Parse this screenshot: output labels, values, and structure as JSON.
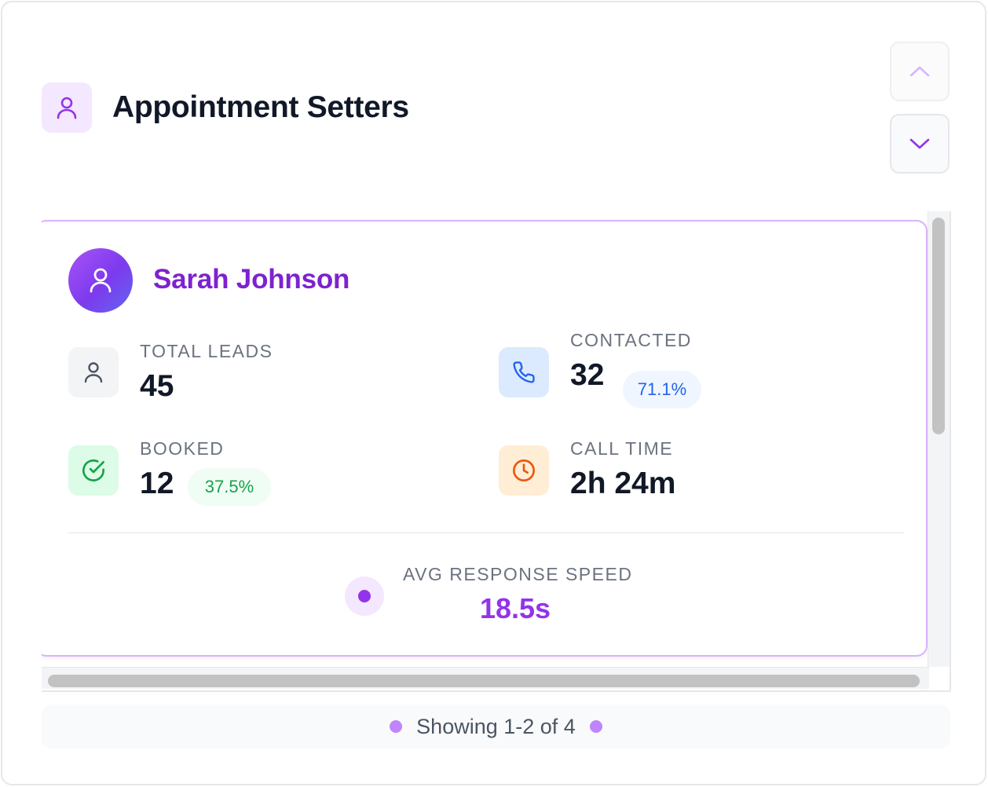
{
  "header": {
    "title": "Appointment Setters",
    "icon": "user-icon"
  },
  "nav": {
    "up_icon": "chevron-up-icon",
    "down_icon": "chevron-down-icon"
  },
  "card": {
    "name": "Sarah Johnson",
    "avatar_icon": "user-icon",
    "stats": {
      "total_leads": {
        "label": "TOTAL LEADS",
        "value": "45",
        "icon": "user-icon"
      },
      "contacted": {
        "label": "CONTACTED",
        "value": "32",
        "rate": "71.1%",
        "icon": "phone-icon"
      },
      "booked": {
        "label": "BOOKED",
        "value": "12",
        "rate": "37.5%",
        "icon": "check-circle-icon"
      },
      "call_time": {
        "label": "CALL TIME",
        "value": "2h 24m",
        "icon": "clock-icon"
      }
    },
    "response": {
      "label": "AVG RESPONSE SPEED",
      "value": "18.5s"
    }
  },
  "footer": {
    "text": "Showing 1-2 of 4"
  },
  "colors": {
    "accent": "#9333ea",
    "name": "#7e22ce",
    "contacted_bg": "#dbeafe",
    "booked_bg": "#dcfce7",
    "call_time_bg": "#ffedd5"
  }
}
